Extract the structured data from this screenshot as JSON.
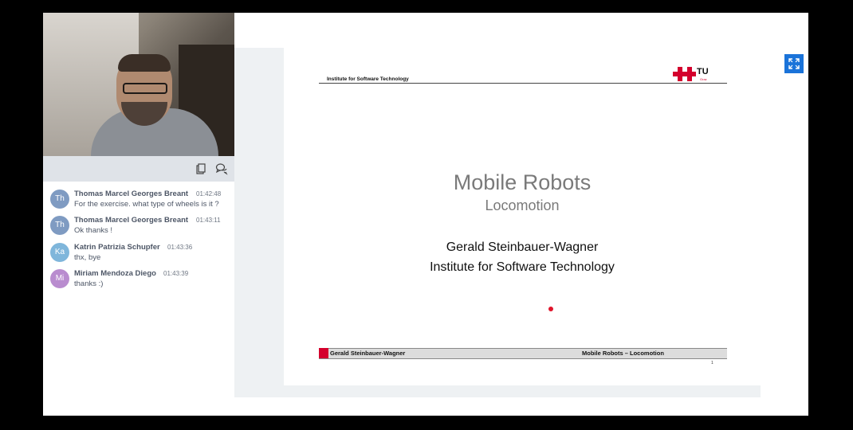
{
  "chat": {
    "messages": [
      {
        "initials": "Th",
        "name": "Thomas Marcel Georges Breant",
        "time": "01:42:48",
        "text": "For the exercise. what type of wheels is it ?",
        "avatar_color": "#7f9bc2"
      },
      {
        "initials": "Th",
        "name": "Thomas Marcel Georges Breant",
        "time": "01:43:11",
        "text": "Ok thanks !",
        "avatar_color": "#7f9bc2"
      },
      {
        "initials": "Ka",
        "name": "Katrin Patrizia Schupfer",
        "time": "01:43:36",
        "text": "thx, bye",
        "avatar_color": "#7fb6db"
      },
      {
        "initials": "Mi",
        "name": "Miriam Mendoza Diego",
        "time": "01:43:39",
        "text": "thanks :)",
        "avatar_color": "#b98ccf"
      }
    ]
  },
  "toolbar": {
    "icons": [
      "clipboard-icon",
      "chat-bubbles-icon"
    ]
  },
  "slide": {
    "header": "Institute for Software Technology",
    "logo_text": "TU",
    "logo_sub": "Graz",
    "title": "Mobile Robots",
    "subtitle": "Locomotion",
    "author": "Gerald Steinbauer-Wagner",
    "institute": "Institute for Software Technology",
    "footer_left": "Gerald Steinbauer-Wagner",
    "footer_right": "Mobile Robots – Locomotion",
    "page_number": "1"
  },
  "controls": {
    "fullscreen_icon": "fullscreen-icon"
  },
  "colors": {
    "accent": "#1a73d9",
    "tu_red": "#d4002d"
  }
}
